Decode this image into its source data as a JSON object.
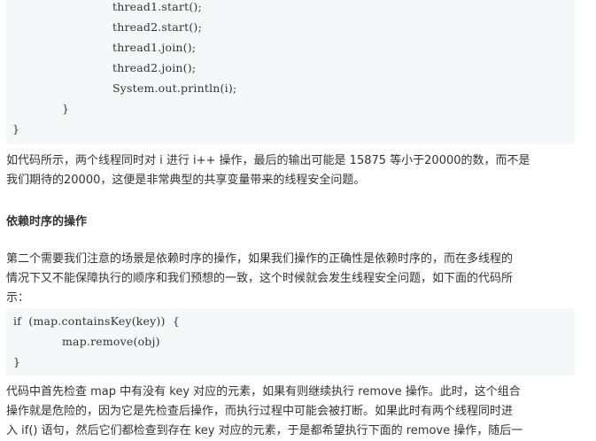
{
  "code_block_1": {
    "lines": [
      "thread1.start();",
      "thread2.start();",
      "thread1.join();",
      "thread2.join();",
      "System.out.println(i);",
      "}",
      "}"
    ]
  },
  "paragraph_1": {
    "line_1": "如代码所示，两个线程同时对 i 进行 i++ 操作，最后的输出可能是 15875 等小于20000的数，而不是",
    "line_2": "我们期待的20000，这便是非常典型的共享变量带来的线程安全问题。"
  },
  "section_heading": "依赖时序的操作",
  "paragraph_2": {
    "line_1": "第二个需要我们注意的场景是依赖时序的操作，如果我们操作的正确性是依赖时序的，而在多线程的",
    "line_2": "情况下又不能保障执行的顺序和我们预想的一致，这个时候就会发生线程安全问题，如下面的代码所",
    "line_3": "示："
  },
  "code_block_2": {
    "lines": [
      "if  (map.containsKey(key))  {",
      "map.remove(obj)",
      "}"
    ]
  },
  "paragraph_3": {
    "line_1": "代码中首先检查 map 中有没有 key 对应的元素，如果有则继续执行 remove 操作。此时，这个组合",
    "line_2": "操作就是危险的，因为它是先检查后操作，而执行过程中可能会被打断。如果此时有两个线程同时进",
    "line_3": "入 if() 语句，然后它们都检查到存在 key 对应的元素，于是都希望执行下面的 remove 操作，随后一"
  }
}
